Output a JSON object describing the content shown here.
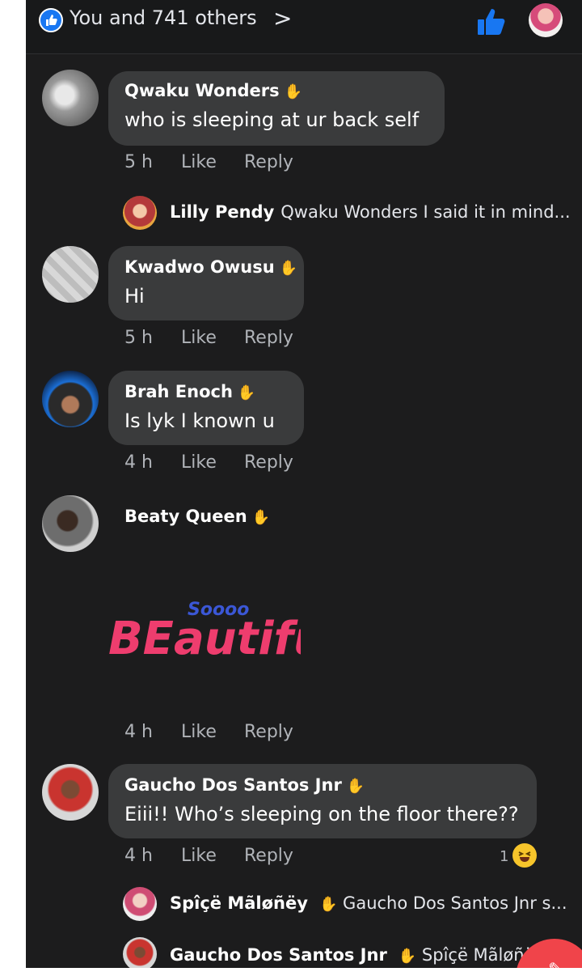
{
  "header": {
    "reactions_text": "You and 741 others",
    "chevron_glyph": ">",
    "accent_color": "#1877f2"
  },
  "comments": [
    {
      "name": "Qwaku Wonders",
      "text": "who is sleeping at ur back self",
      "time": "5 h",
      "like": "Like",
      "reply": "Reply",
      "replies": [
        {
          "name": "Lilly Pendy",
          "text": "Qwaku Wonders I said it in mind..."
        }
      ]
    },
    {
      "name": "Kwadwo Owusu",
      "text": "Hi",
      "time": "5 h",
      "like": "Like",
      "reply": "Reply"
    },
    {
      "name": "Brah Enoch",
      "text": "Is lyk I known u",
      "time": "4 h",
      "like": "Like",
      "reply": "Reply"
    },
    {
      "name": "Beaty Queen",
      "sticker_text": "BEautiful",
      "sticker_overlay": "Soooo",
      "time": "4 h",
      "like": "Like",
      "reply": "Reply"
    },
    {
      "name": "Gaucho Dos Santos Jnr",
      "text": "Eiii!! Who’s sleeping on the floor there??",
      "time": "4 h",
      "like": "Like",
      "reply": "Reply",
      "reaction_count": "1",
      "reaction_icon": "laugh-emoji-icon",
      "replies": [
        {
          "name": "Spîçë Mãløñëy",
          "text": "Gaucho Dos Santos Jnr s..."
        },
        {
          "name": "Gaucho Dos Santos Jnr",
          "text": "Spîçë Mãløñë"
        }
      ]
    }
  ],
  "icons": {
    "wave": "✋",
    "laugh": "😆"
  }
}
